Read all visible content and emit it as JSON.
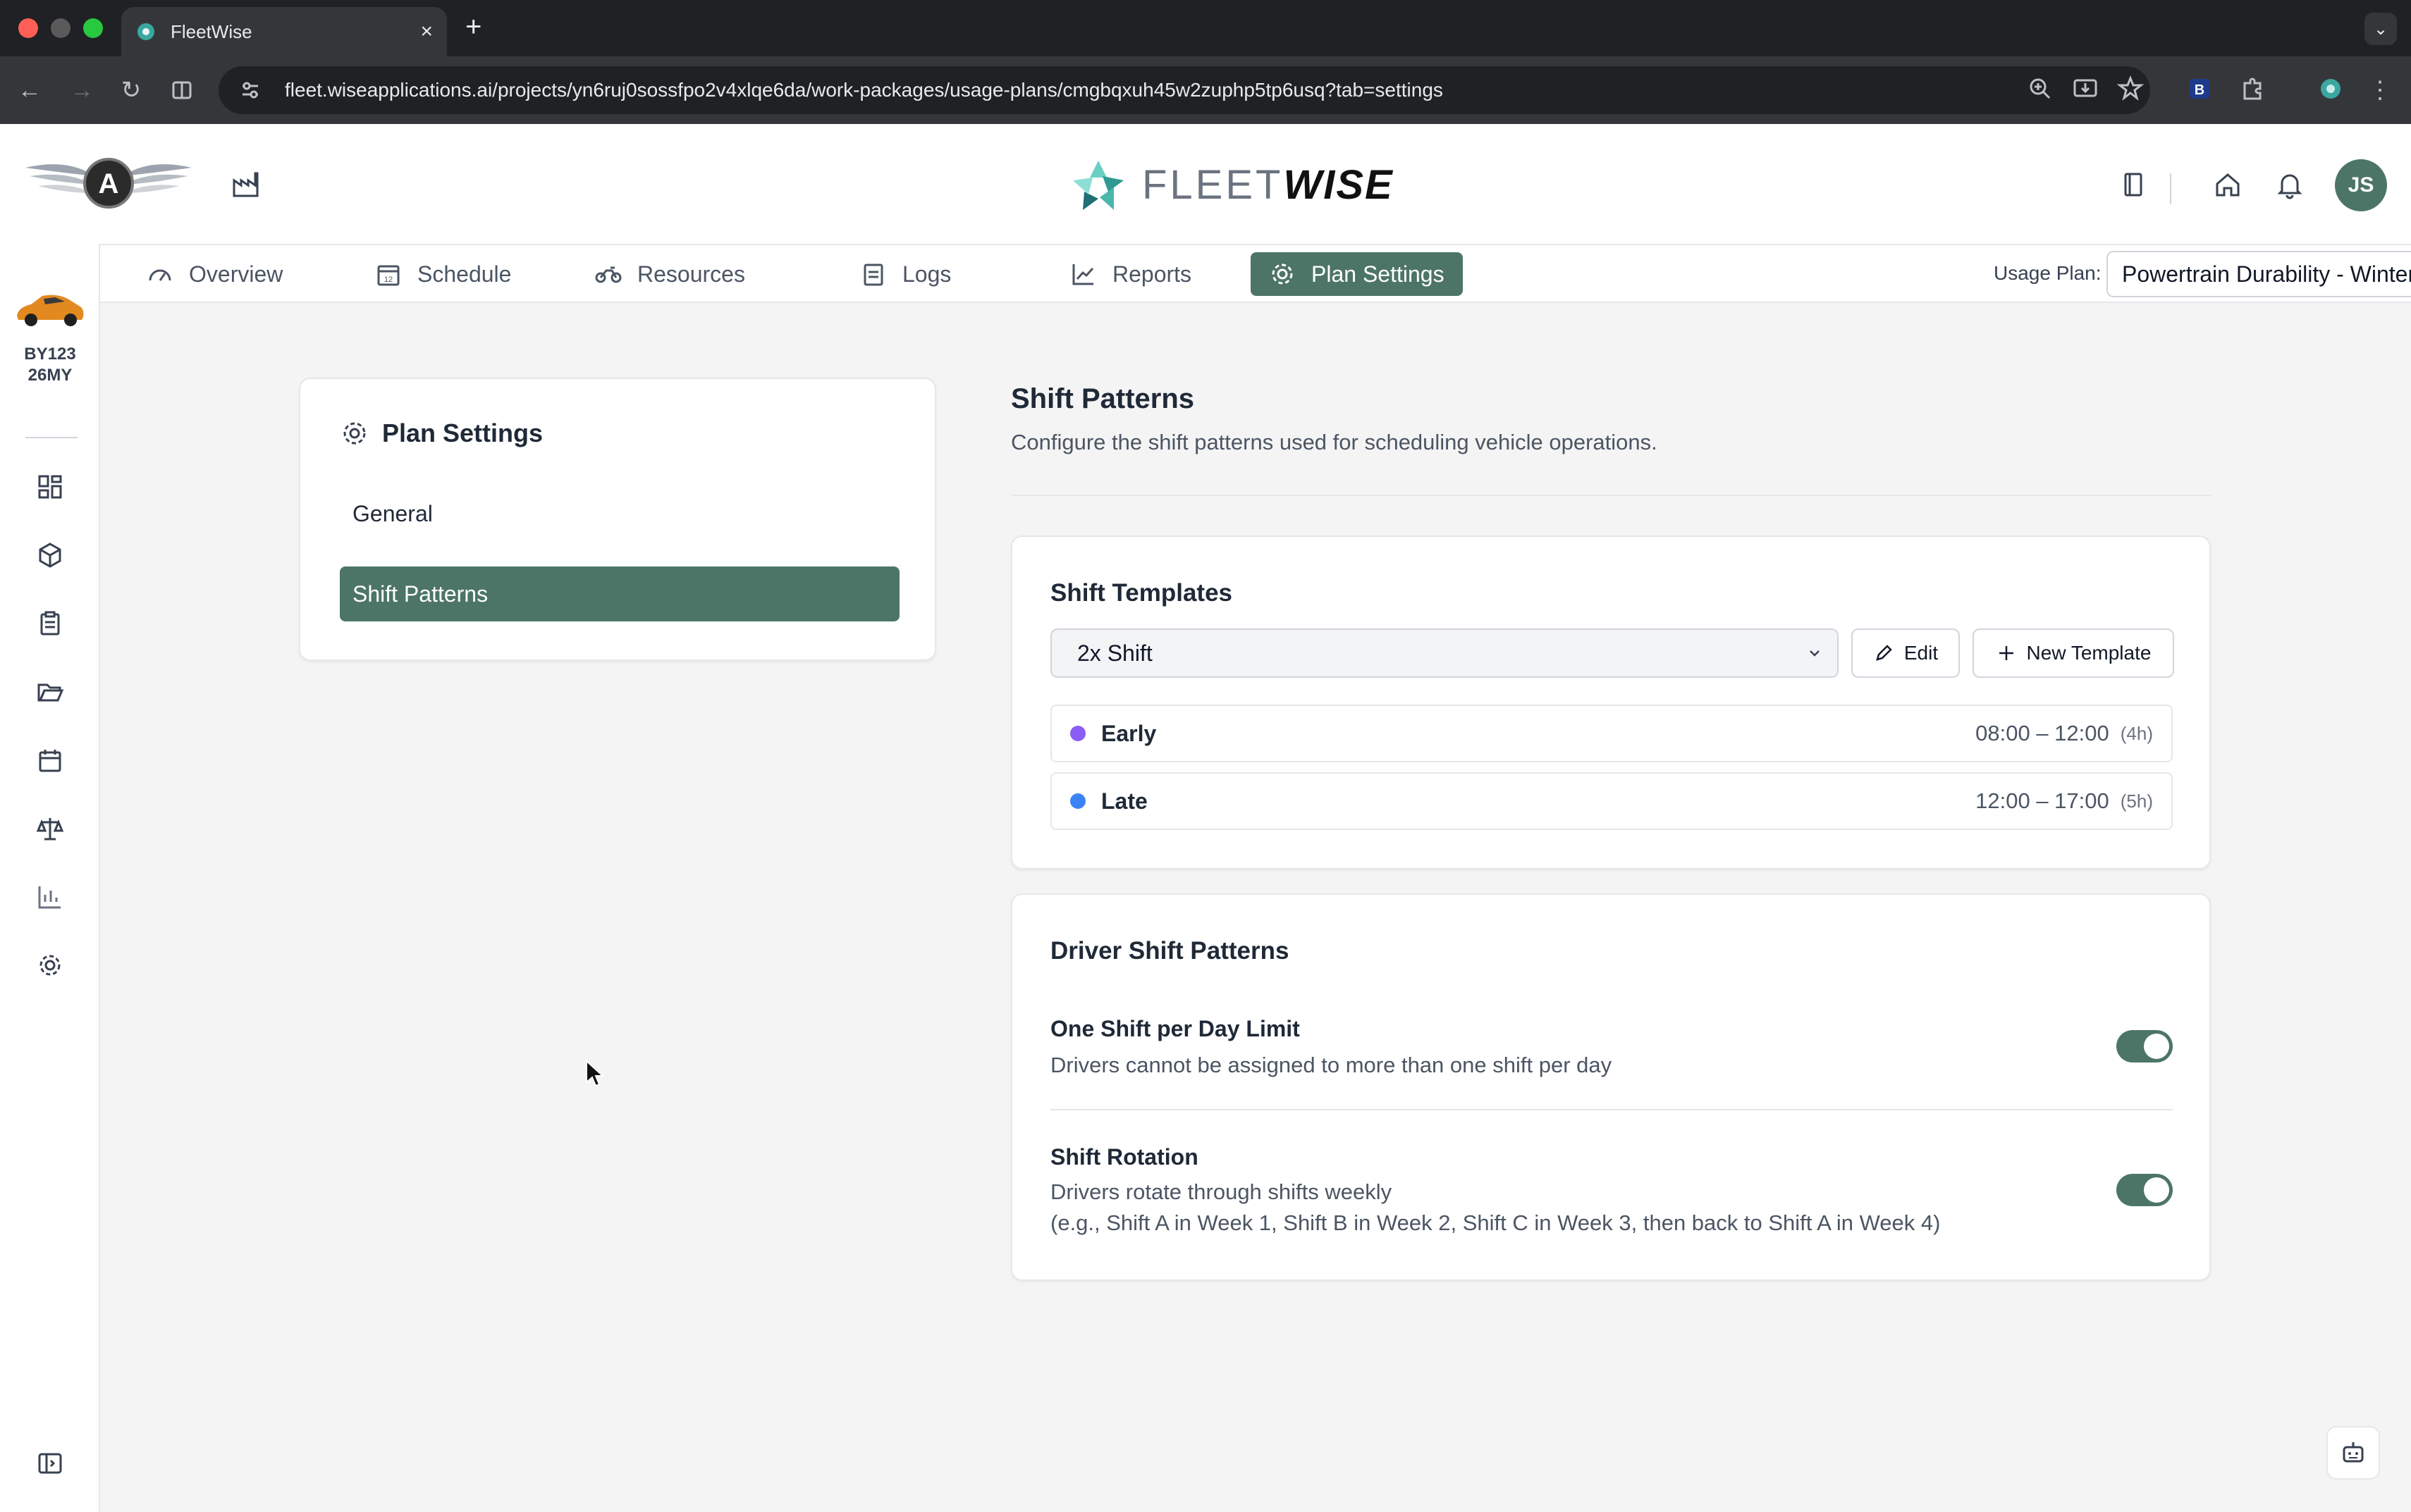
{
  "browser": {
    "tab_title": "FleetWise",
    "url": "fleet.wiseapplications.ai/projects/yn6ruj0sossfpo2v4xlqe6da/work-packages/usage-plans/cmgbqxuh45w2zuphp5tp6usq?tab=settings"
  },
  "header": {
    "logo_text_light": "FLEET",
    "logo_text_bold": "WISE",
    "avatar_initials": "JS"
  },
  "vehicle": {
    "id": "BY123",
    "model_year": "26MY"
  },
  "nav": {
    "tabs": [
      {
        "label": "Overview",
        "icon": "gauge-icon"
      },
      {
        "label": "Schedule",
        "icon": "calendar-icon"
      },
      {
        "label": "Resources",
        "icon": "motorbike-icon"
      },
      {
        "label": "Logs",
        "icon": "clipboard-icon"
      },
      {
        "label": "Reports",
        "icon": "trend-icon"
      },
      {
        "label": "Plan Settings",
        "icon": "gear-icon",
        "active": true
      }
    ],
    "usage_plan_label": "Usage Plan:",
    "usage_plan_value": "Powertrain Durability - Winter"
  },
  "settings_sidebar": {
    "title": "Plan Settings",
    "items": [
      {
        "label": "General"
      },
      {
        "label": "Shift Patterns",
        "active": true
      }
    ]
  },
  "main": {
    "title": "Shift Patterns",
    "description": "Configure the shift patterns used for scheduling vehicle operations.",
    "templates": {
      "title": "Shift Templates",
      "selected": "2x Shift",
      "edit_label": "Edit",
      "new_label": "New Template",
      "shifts": [
        {
          "name": "Early",
          "time": "08:00 – 12:00",
          "duration": "(4h)",
          "color": "#8b5cf6"
        },
        {
          "name": "Late",
          "time": "12:00 – 17:00",
          "duration": "(5h)",
          "color": "#3b82f6"
        }
      ]
    },
    "driver_patterns": {
      "title": "Driver Shift Patterns",
      "options": [
        {
          "title": "One Shift per Day Limit",
          "desc": "Drivers cannot be assigned to more than one shift per day",
          "enabled": true
        },
        {
          "title": "Shift Rotation",
          "desc": "Drivers rotate through shifts weekly",
          "desc2": "(e.g., Shift A in Week 1, Shift B in Week 2, Shift C in Week 3, then back to Shift A in Week 4)",
          "enabled": true
        }
      ]
    }
  },
  "colors": {
    "accent": "#4d7567"
  }
}
